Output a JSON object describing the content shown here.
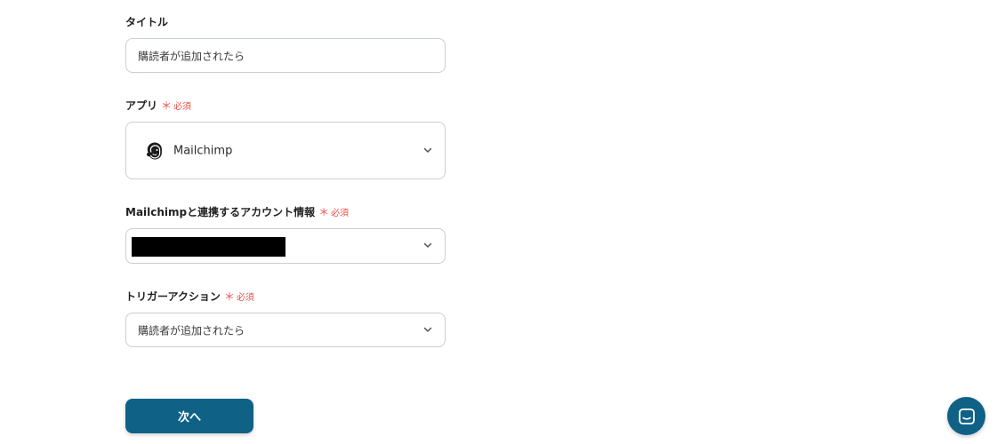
{
  "form": {
    "title_field": {
      "label": "タイトル",
      "value": "購読者が追加されたら"
    },
    "app_field": {
      "label": "アプリ",
      "required_mark": "＊",
      "required_text": "必須",
      "selected_app": "Mailchimp",
      "app_icon": "mailchimp-logo"
    },
    "account_field": {
      "label": "Mailchimpと連携するアカウント情報",
      "required_mark": "＊",
      "required_text": "必須"
    },
    "trigger_field": {
      "label": "トリガーアクション",
      "required_mark": "＊",
      "required_text": "必須",
      "value": "購読者が追加されたら"
    }
  },
  "actions": {
    "next_label": "次へ"
  },
  "colors": {
    "primary": "#0f6286",
    "required": "#e8504a",
    "border": "#c9ced6"
  }
}
